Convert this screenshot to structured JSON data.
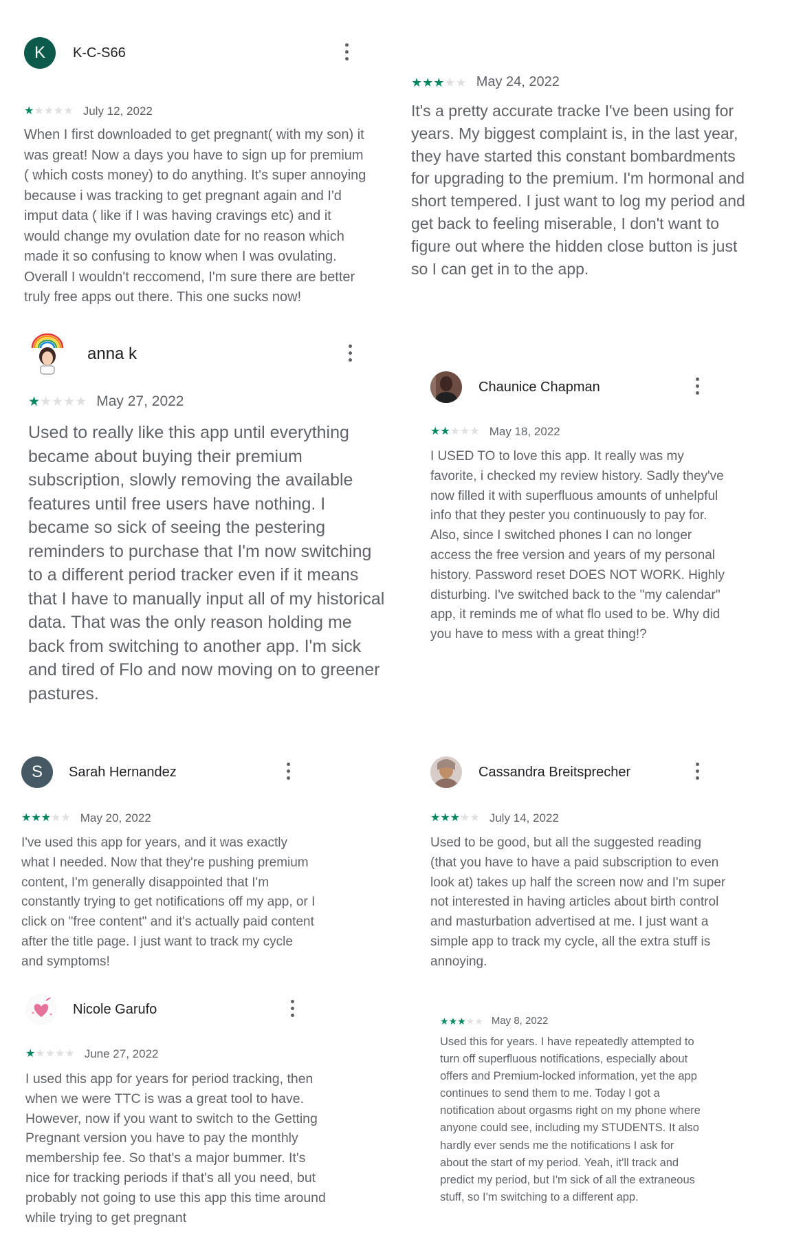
{
  "reviews": [
    {
      "name": "K-C-S66",
      "avatar_letter": "K",
      "avatar_color": "#0b5a4b",
      "rating": 1,
      "date": "July 12, 2022",
      "text": "When I first downloaded to get pregnant( with my son) it was great! Now a days you have to sign up for premium ( which costs money) to do anything. It's super annoying because i was tracking to get pregnant again and I'd imput data ( like if I was having cravings etc) and it would change my ovulation date for no reason which made it so confusing to know when I was ovulating. Overall I wouldn't reccomend, I'm sure there are better truly free apps out there. This one sucks now!"
    },
    {
      "rating": 3,
      "date": "May 24, 2022",
      "text": "It's a pretty accurate tracke I've been using for years. My biggest complaint is, in the last year, they have started this constant bombardments for upgrading to the premium. I'm hormonal and short tempered. I just want to log my period and get back to feeling miserable, I don't want to figure out where the hidden close button is just so I can get in to the app."
    },
    {
      "name": "anna k",
      "avatar_icon": "rainbow-girl-avatar",
      "rating": 1,
      "date": "May 27, 2022",
      "text": "Used to really like this app until everything became about buying their premium subscription, slowly removing the available features until free users have nothing. I became so sick of seeing the pestering reminders to purchase that I'm now switching to a different period tracker even if it means that I have to manually input all of my historical data. That was the only reason holding me back from switching to another app. I'm sick and tired of Flo and now moving on to greener pastures."
    },
    {
      "name": "Chaunice Chapman",
      "avatar_icon": "photo-avatar",
      "rating": 2,
      "date": "May 18, 2022",
      "text": "I USED TO to love this app. It really was my favorite, i checked my review history. Sadly they've now filled it with superfluous amounts of unhelpful info that they pester you continuously to pay for. Also, since I switched phones I can no longer access the free version and years of my personal history. Password reset DOES NOT WORK. Highly disturbing. I've switched back to the \"my calendar\" app, it reminds me of what flo used to be. Why did you have to mess with a great thing!?"
    },
    {
      "name": "Sarah Hernandez",
      "avatar_letter": "S",
      "avatar_color": "#455a64",
      "rating": 3,
      "date": "May 20, 2022",
      "text": "I've used this app for years, and it was exactly what I needed. Now that they're pushing premium content, I'm generally disappointed that I'm constantly trying to get notifications off my app, or I click on \"free content\" and it's actually paid content after the title page. I just want to track my cycle and symptoms!"
    },
    {
      "name": "Cassandra Breitsprecher",
      "avatar_icon": "photo-avatar",
      "rating": 3,
      "date": "July 14, 2022",
      "text": "Used to be good, but all the suggested reading (that you have to have a paid subscription to even look at) takes up half the screen now and I'm super not interested in having articles about birth control and masturbation advertised at me. I just want a simple app to track my cycle, all the extra stuff is annoying."
    },
    {
      "name": "Nicole Garufo",
      "avatar_icon": "heart-avatar",
      "rating": 1,
      "date": "June 27, 2022",
      "text": "I used this app for years for period tracking, then when we were TTC is was a great tool to have. However, now if you want to switch to the Getting Pregnant version you have to pay the monthly membership fee. So that's a major bummer. It's nice for tracking periods if that's all you need, but probably not going to use this app this time around while trying to get pregnant"
    },
    {
      "rating": 3,
      "date": "May 8, 2022",
      "text": "Used this for years. I have repeatedly attempted to turn off superfluous notifications, especially about offers and Premium-locked information, yet the app continues to send them to me. Today I got a notification about orgasms right on my phone where anyone could see, including my STUDENTS. It also hardly ever sends me the notifications I ask for about the start of my period. Yeah, it'll track and predict my period, but I'm sick of all the extraneous stuff, so I'm switching to a different app."
    }
  ]
}
